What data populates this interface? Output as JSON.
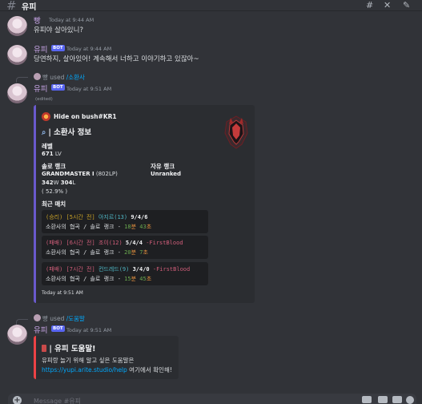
{
  "channel": {
    "hash": "#",
    "title": "유피"
  },
  "icons": [
    "threads-icon",
    "mute-bell-icon",
    "pin-icon"
  ],
  "messages": [
    {
      "author": "빵",
      "time": "Today at 9:44 AM",
      "text": "유피야 살아있니?"
    },
    {
      "author": "유피",
      "badge": "BOT",
      "time": "Today at 9:44 AM",
      "text": "당연하지, 살아있어! 계속해서 너하고 이야기하고 있잖아~"
    },
    {
      "reply": {
        "user": "빵",
        "used": "used",
        "command": "/소환사"
      },
      "author": "유피",
      "badge": "BOT",
      "time": "Today at 9:51 AM",
      "edited": "(edited)",
      "embed": {
        "author": "Hide on bush#KR1",
        "title": "소환사 정보",
        "level_label": "레벨",
        "level_value": "671",
        "level_unit": "LV",
        "solo_label": "솔로 랭크",
        "solo_tier": "GRANDMASTER I",
        "solo_lp": "(802LP)",
        "solo_w": "342",
        "solo_l": "304",
        "solo_rate": "( 52.9% )",
        "flex_label": "자유 랭크",
        "flex_value": "Unranked",
        "recent_label": "최근 매치",
        "matches": [
          {
            "result": "(승리)",
            "ago": "[5시간 전]",
            "champ": "아지르(13)",
            "kda": "9/4/6",
            "extra": "",
            "mode": "소환사의 협곡 / 솔로 랭크",
            "sep": " - ",
            "min": "18",
            "min_u": "분",
            "sec": "43",
            "sec_u": "초"
          },
          {
            "result": "(패배)",
            "ago": "[6시간 전]",
            "champ": "조이(12)",
            "kda": "5/4/4",
            "extra": " -FirstBlood",
            "mode": "소환사의 협곡 / 솔로 랭크",
            "sep": " - ",
            "min": "20",
            "min_u": "분",
            "sec": "7",
            "sec_u": "초"
          },
          {
            "result": "(패배)",
            "ago": "[7시간 전]",
            "champ": "컨드레드(9)",
            "kda": "3/4/0",
            "extra": " -FirstBlood",
            "mode": "소환사의 협곡 / 솔로 랭크",
            "sep": " - ",
            "min": "15",
            "min_u": "분",
            "sec": "45",
            "sec_u": "초"
          }
        ],
        "footer": "Today at 9:51 AM"
      }
    },
    {
      "reply": {
        "user": "빵",
        "used": "used",
        "command": "/도움말"
      },
      "author": "유피",
      "badge": "BOT",
      "time": "Today at 9:51 AM",
      "embed": {
        "title": "| 유피 도움말!",
        "line1": "유피랑 놀기 위해 알고 싶은 도움말은",
        "link": "https://yupi.arite.studio/help",
        "line2_suffix": " 여기에서 확인해!"
      }
    }
  ],
  "composer": {
    "placeholder": "Message #유피"
  },
  "colors": {
    "background": "#313338",
    "embed": "#2b2d31",
    "accent": "#6a5acd",
    "bot_badge": "#5865f2",
    "link": "#00a8fc"
  }
}
